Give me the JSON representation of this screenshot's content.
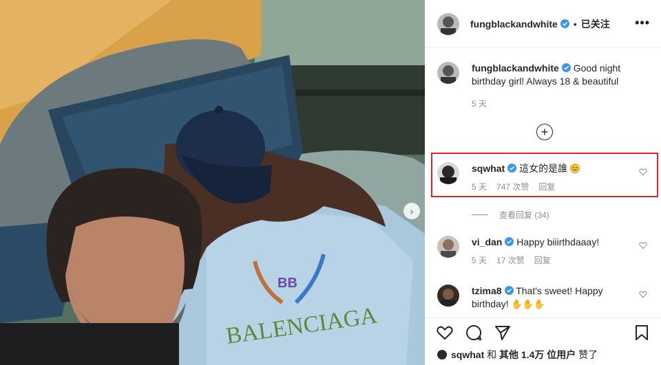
{
  "post": {
    "author": "fungblackandwhite",
    "follow_status": "已关注",
    "separator": "•"
  },
  "caption": {
    "user": "fungblackandwhite",
    "text_line1": "Good night",
    "text_line2": "birthday girl! Always 18 & beautiful",
    "age": "5 天"
  },
  "comments": [
    {
      "user": "sqwhat",
      "text": "這女的是誰",
      "emoji": "smiling-face",
      "age": "5 天",
      "likes": "747 次赞",
      "reply": "回复"
    },
    {
      "user": "vi_dan",
      "text": "Happy biiirthdaaay!",
      "age": "5 天",
      "likes": "17 次赞",
      "reply": "回复"
    },
    {
      "user": "tzima8",
      "text_line1": "That's sweet! Happy",
      "text_line2": "birthday!",
      "emoji": "clapping-hands x3"
    }
  ],
  "view_replies": "查看回复 (34)",
  "likes_line": {
    "user": "sqwhat",
    "and": "和",
    "others": "其他 1.4万 位用户",
    "liked": "赞了"
  },
  "image": {
    "sweatshirt_text": "BALENCIAGA",
    "logo_text": "BB"
  },
  "colors": {
    "highlight": "#e0242c",
    "verified": "#3897f0",
    "muted": "#8e8e8e"
  }
}
